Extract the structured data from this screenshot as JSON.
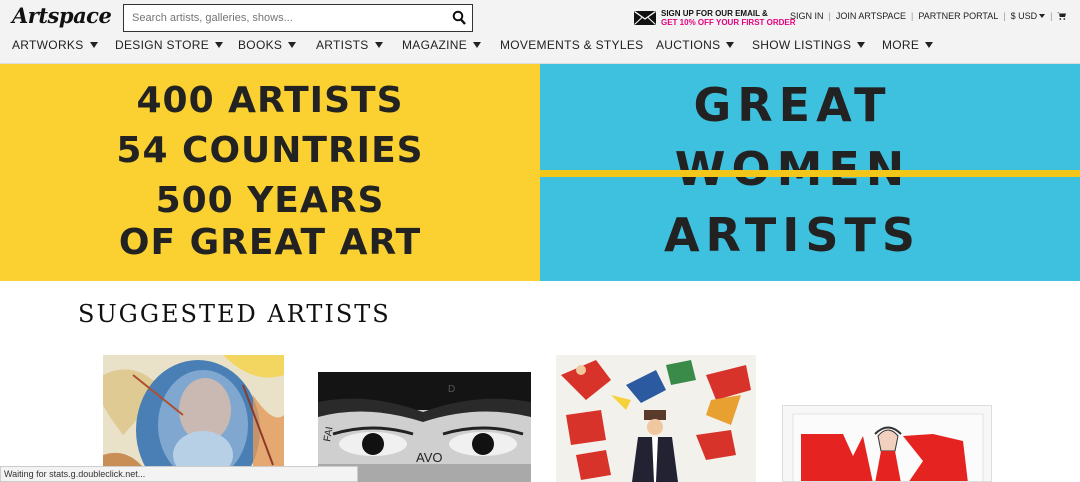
{
  "header": {
    "logo": "Artspace",
    "search_placeholder": "Search artists, galleries, shows...",
    "promo_line1": "SIGN UP FOR OUR EMAIL &",
    "promo_line2": "GET 10% OFF YOUR FIRST ORDER",
    "sign_in": "SIGN IN",
    "join": "JOIN ARTSPACE",
    "partner": "PARTNER PORTAL",
    "currency": "$ USD"
  },
  "nav": [
    {
      "label": "ARTWORKS",
      "dropdown": true
    },
    {
      "label": "DESIGN STORE",
      "dropdown": true
    },
    {
      "label": "BOOKS",
      "dropdown": true
    },
    {
      "label": "ARTISTS",
      "dropdown": true
    },
    {
      "label": "MAGAZINE",
      "dropdown": true
    },
    {
      "label": "MOVEMENTS & STYLES",
      "dropdown": false
    },
    {
      "label": "AUCTIONS",
      "dropdown": true
    },
    {
      "label": "SHOW LISTINGS",
      "dropdown": true
    },
    {
      "label": "MORE",
      "dropdown": true
    }
  ],
  "banner_left": {
    "lines": [
      "400 ARTISTS",
      "54 COUNTRIES",
      "500 YEARS",
      "OF GREAT ART"
    ],
    "color": "#fad130"
  },
  "banner_right": {
    "words": [
      "GREAT",
      "WOMEN",
      "ARTISTS"
    ],
    "color": "#3ec0df"
  },
  "suggested": {
    "title": "SUGGESTED ARTISTS",
    "artwork2_text": [
      "AVO",
      "FAI",
      "D"
    ]
  },
  "status_bar": "Waiting for stats.g.doubleclick.net..."
}
